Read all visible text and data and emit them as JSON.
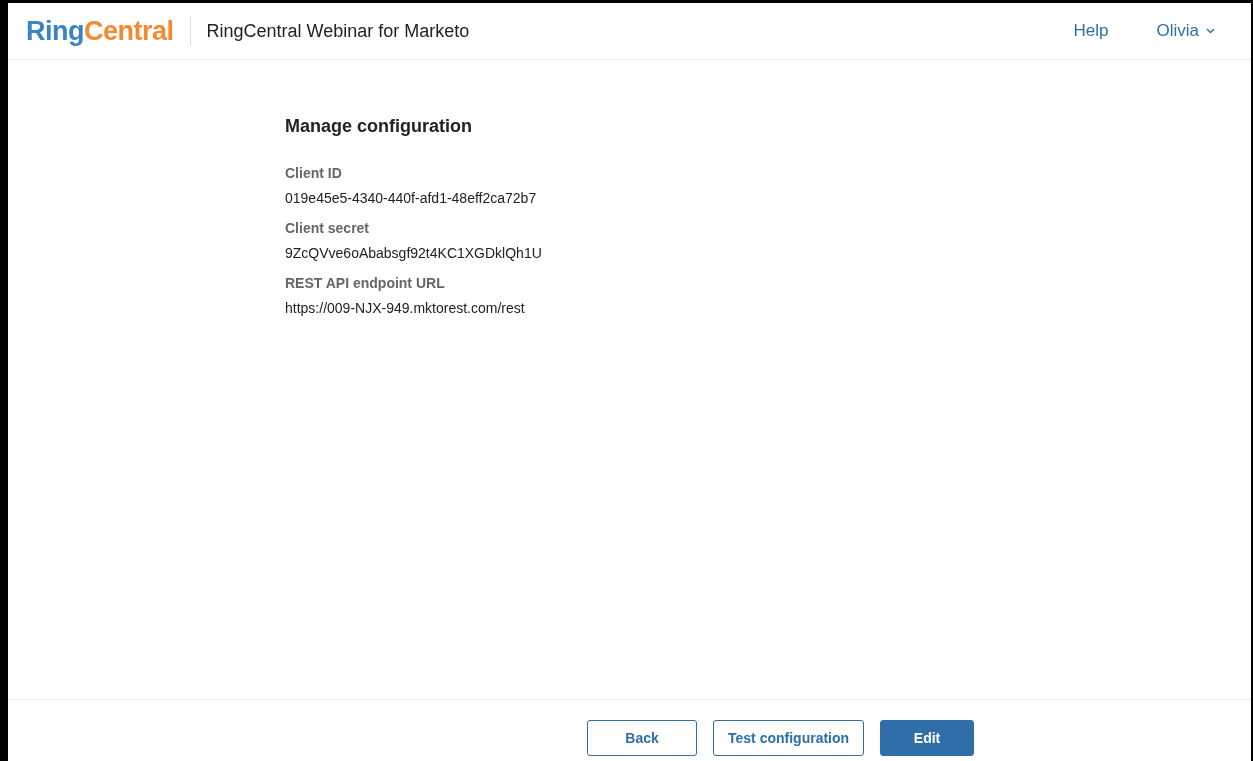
{
  "header": {
    "logo_parts": [
      {
        "text": "Ring",
        "color": "#3a83c4"
      },
      {
        "text": "Central",
        "color": "#f28b30"
      }
    ],
    "app_title": "RingCentral Webinar for Marketo",
    "nav": [
      {
        "label": "Help",
        "kind": "link"
      },
      {
        "label": "Olivia",
        "kind": "menu"
      }
    ]
  },
  "page": {
    "title": "Manage configuration",
    "fields": [
      {
        "label": "Client ID",
        "value": "019e45e5-4340-440f-afd1-48eff2ca72b7"
      },
      {
        "label": "Client secret",
        "value": "9ZcQVve6oAbabsgf92t4KC1XGDklQh1U"
      },
      {
        "label": "REST API endpoint URL",
        "value": "https://009-NJX-949.mktorest.com/rest"
      }
    ]
  },
  "footer": {
    "buttons": [
      {
        "label": "Back",
        "kind": "secondary"
      },
      {
        "label": "Test configuration",
        "kind": "secondary"
      },
      {
        "label": "Edit",
        "kind": "primary"
      }
    ]
  }
}
